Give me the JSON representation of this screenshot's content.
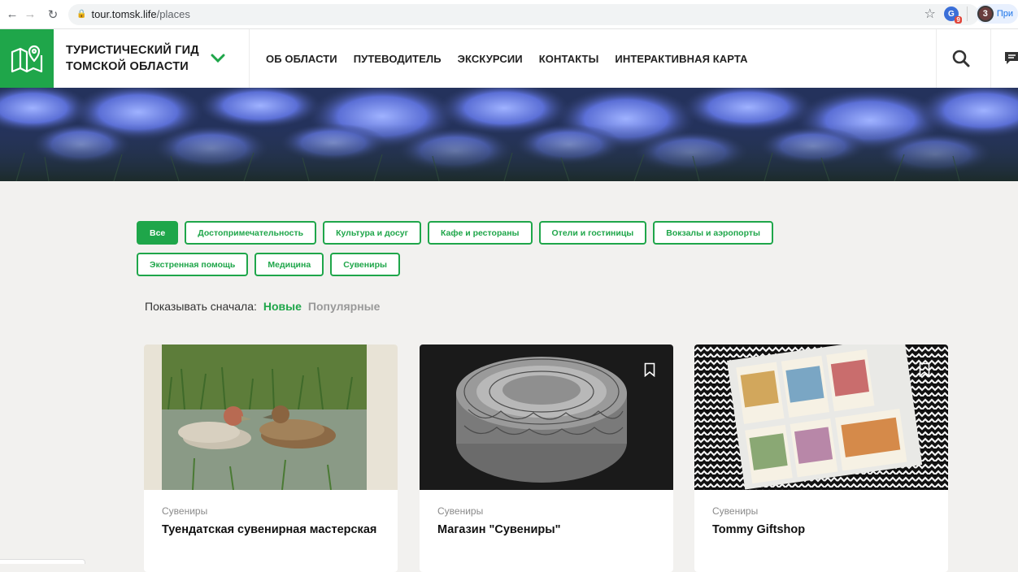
{
  "browser": {
    "url_host": "tour.tomsk.life",
    "url_path": "/places",
    "profile_count": "3",
    "profile_label": "При",
    "ext_badge": "9"
  },
  "header": {
    "brand_line1": "ТУРИСТИЧЕСКИЙ ГИД",
    "brand_line2": "ТОМСКОЙ ОБЛАСТИ",
    "nav": [
      "ОБ ОБЛАСТИ",
      "ПУТЕВОДИТЕЛЬ",
      "ЭКСКУРСИИ",
      "КОНТАКТЫ",
      "ИНТЕРАКТИВНАЯ КАРТА"
    ]
  },
  "filters": {
    "row1": [
      "Все",
      "Достопримечательность",
      "Культура и досуг",
      "Кафе и рестораны",
      "Отели и гостиницы",
      "Вокзалы и аэропорты"
    ],
    "row2": [
      "Экстренная помощь",
      "Медицина",
      "Сувениры"
    ],
    "active": "Все"
  },
  "sort": {
    "label": "Показывать сначала:",
    "options": [
      "Новые",
      "Популярные"
    ],
    "selected": "Новые"
  },
  "cards": [
    {
      "category": "Сувениры",
      "title": "Туендатская сувенирная мастерская"
    },
    {
      "category": "Сувениры",
      "title": "Магазин \"Сувениры\""
    },
    {
      "category": "Сувениры",
      "title": "Tommy Giftshop"
    }
  ],
  "colors": {
    "accent": "#1fa64a",
    "text": "#222222",
    "muted": "#999999",
    "page_bg": "#f2f1ef"
  }
}
